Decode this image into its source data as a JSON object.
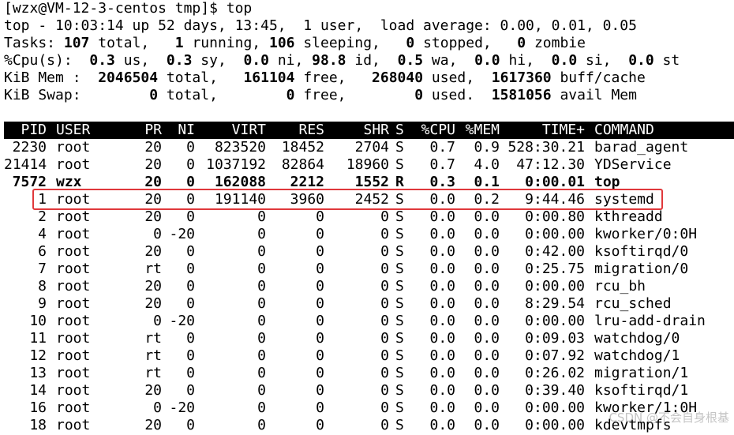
{
  "prompt_line": "[wzx@VM-12-3-centos tmp]$ top",
  "summary": {
    "uptime_line": "top - 10:03:14 up 52 days, 13:45,  1 user,  load average: 0.00, 0.01, 0.05",
    "tasks": {
      "label": "Tasks:",
      "total": "107",
      "total_label": " total,   ",
      "running": "1",
      "running_label": " running, ",
      "sleeping": "106",
      "sleeping_label": " sleeping,   ",
      "stopped": "0",
      "stopped_label": " stopped,   ",
      "zombie": "0",
      "zombie_label": " zombie"
    },
    "cpu": {
      "label": "%Cpu(s):  ",
      "us": "0.3",
      "us_label": " us,  ",
      "sy": "0.3",
      "sy_label": " sy,  ",
      "ni": "0.0",
      "ni_label": " ni, ",
      "id": "98.8",
      "id_label": " id,  ",
      "wa": "0.5",
      "wa_label": " wa,  ",
      "hi": "0.0",
      "hi_label": " hi,  ",
      "si": "0.0",
      "si_label": " si,  ",
      "st": "0.0",
      "st_label": " st"
    },
    "mem": {
      "label": "KiB Mem :  ",
      "total": "2046504",
      "total_label": " total,   ",
      "free": "161104",
      "free_label": " free,   ",
      "used": "268040",
      "used_label": " used,  ",
      "buff": "1617360",
      "buff_label": " buff/cache"
    },
    "swap": {
      "label": "KiB Swap:        ",
      "total": "0",
      "total_label": " total,        ",
      "free": "0",
      "free_label": " free,        ",
      "used": "0",
      "used_label": " used.  ",
      "avail": "1581056",
      "avail_label": " avail Mem"
    }
  },
  "columns": {
    "pid": "PID",
    "user": "USER",
    "pr": "PR",
    "ni": "NI",
    "virt": "VIRT",
    "res": "RES",
    "shr": "SHR",
    "s": "S",
    "cpu": "%CPU",
    "mem": "%MEM",
    "time": "TIME+",
    "cmd": "COMMAND"
  },
  "processes": [
    {
      "pid": "2230",
      "user": "root",
      "pr": "20",
      "ni": "0",
      "virt": "823520",
      "res": "18452",
      "shr": "2704",
      "s": "S",
      "cpu": "0.7",
      "mem": "0.9",
      "time": "528:30.21",
      "cmd": "barad_agent"
    },
    {
      "pid": "21414",
      "user": "root",
      "pr": "20",
      "ni": "0",
      "virt": "1037192",
      "res": "82864",
      "shr": "18960",
      "s": "S",
      "cpu": "0.7",
      "mem": "4.0",
      "time": "47:12.30",
      "cmd": "YDService"
    },
    {
      "pid": "7572",
      "user": "wzx",
      "pr": "20",
      "ni": "0",
      "virt": "162088",
      "res": "2212",
      "shr": "1552",
      "s": "R",
      "cpu": "0.3",
      "mem": "0.1",
      "time": "0:00.01",
      "cmd": "top"
    },
    {
      "pid": "1",
      "user": "root",
      "pr": "20",
      "ni": "0",
      "virt": "191140",
      "res": "3960",
      "shr": "2452",
      "s": "S",
      "cpu": "0.0",
      "mem": "0.2",
      "time": "9:44.46",
      "cmd": "systemd"
    },
    {
      "pid": "2",
      "user": "root",
      "pr": "20",
      "ni": "0",
      "virt": "0",
      "res": "0",
      "shr": "0",
      "s": "S",
      "cpu": "0.0",
      "mem": "0.0",
      "time": "0:00.80",
      "cmd": "kthreadd"
    },
    {
      "pid": "4",
      "user": "root",
      "pr": "0",
      "ni": "-20",
      "virt": "0",
      "res": "0",
      "shr": "0",
      "s": "S",
      "cpu": "0.0",
      "mem": "0.0",
      "time": "0:00.00",
      "cmd": "kworker/0:0H"
    },
    {
      "pid": "6",
      "user": "root",
      "pr": "20",
      "ni": "0",
      "virt": "0",
      "res": "0",
      "shr": "0",
      "s": "S",
      "cpu": "0.0",
      "mem": "0.0",
      "time": "0:42.00",
      "cmd": "ksoftirqd/0"
    },
    {
      "pid": "7",
      "user": "root",
      "pr": "rt",
      "ni": "0",
      "virt": "0",
      "res": "0",
      "shr": "0",
      "s": "S",
      "cpu": "0.0",
      "mem": "0.0",
      "time": "0:25.75",
      "cmd": "migration/0"
    },
    {
      "pid": "8",
      "user": "root",
      "pr": "20",
      "ni": "0",
      "virt": "0",
      "res": "0",
      "shr": "0",
      "s": "S",
      "cpu": "0.0",
      "mem": "0.0",
      "time": "0:00.00",
      "cmd": "rcu_bh"
    },
    {
      "pid": "9",
      "user": "root",
      "pr": "20",
      "ni": "0",
      "virt": "0",
      "res": "0",
      "shr": "0",
      "s": "S",
      "cpu": "0.0",
      "mem": "0.0",
      "time": "8:29.54",
      "cmd": "rcu_sched"
    },
    {
      "pid": "10",
      "user": "root",
      "pr": "0",
      "ni": "-20",
      "virt": "0",
      "res": "0",
      "shr": "0",
      "s": "S",
      "cpu": "0.0",
      "mem": "0.0",
      "time": "0:00.00",
      "cmd": "lru-add-drain"
    },
    {
      "pid": "11",
      "user": "root",
      "pr": "rt",
      "ni": "0",
      "virt": "0",
      "res": "0",
      "shr": "0",
      "s": "S",
      "cpu": "0.0",
      "mem": "0.0",
      "time": "0:09.03",
      "cmd": "watchdog/0"
    },
    {
      "pid": "12",
      "user": "root",
      "pr": "rt",
      "ni": "0",
      "virt": "0",
      "res": "0",
      "shr": "0",
      "s": "S",
      "cpu": "0.0",
      "mem": "0.0",
      "time": "0:07.92",
      "cmd": "watchdog/1"
    },
    {
      "pid": "13",
      "user": "root",
      "pr": "rt",
      "ni": "0",
      "virt": "0",
      "res": "0",
      "shr": "0",
      "s": "S",
      "cpu": "0.0",
      "mem": "0.0",
      "time": "0:26.02",
      "cmd": "migration/1"
    },
    {
      "pid": "14",
      "user": "root",
      "pr": "20",
      "ni": "0",
      "virt": "0",
      "res": "0",
      "shr": "0",
      "s": "S",
      "cpu": "0.0",
      "mem": "0.0",
      "time": "0:39.40",
      "cmd": "ksoftirqd/1"
    },
    {
      "pid": "16",
      "user": "root",
      "pr": "0",
      "ni": "-20",
      "virt": "0",
      "res": "0",
      "shr": "0",
      "s": "S",
      "cpu": "0.0",
      "mem": "0.0",
      "time": "0:00.00",
      "cmd": "kworker/1:0H"
    },
    {
      "pid": "18",
      "user": "root",
      "pr": "20",
      "ni": "0",
      "virt": "0",
      "res": "0",
      "shr": "0",
      "s": "S",
      "cpu": "0.0",
      "mem": "0.0",
      "time": "0:00.00",
      "cmd": "kdevtmpfs"
    }
  ],
  "bold_process_index": 2,
  "highlighted_process_index": 3,
  "watermark": "CSDN @不会自身根基",
  "colors": {
    "background": "#ffffff",
    "text": "#000000",
    "header_background": "#000000",
    "header_text": "#ffffff",
    "highlight_border": "#e0383b"
  }
}
